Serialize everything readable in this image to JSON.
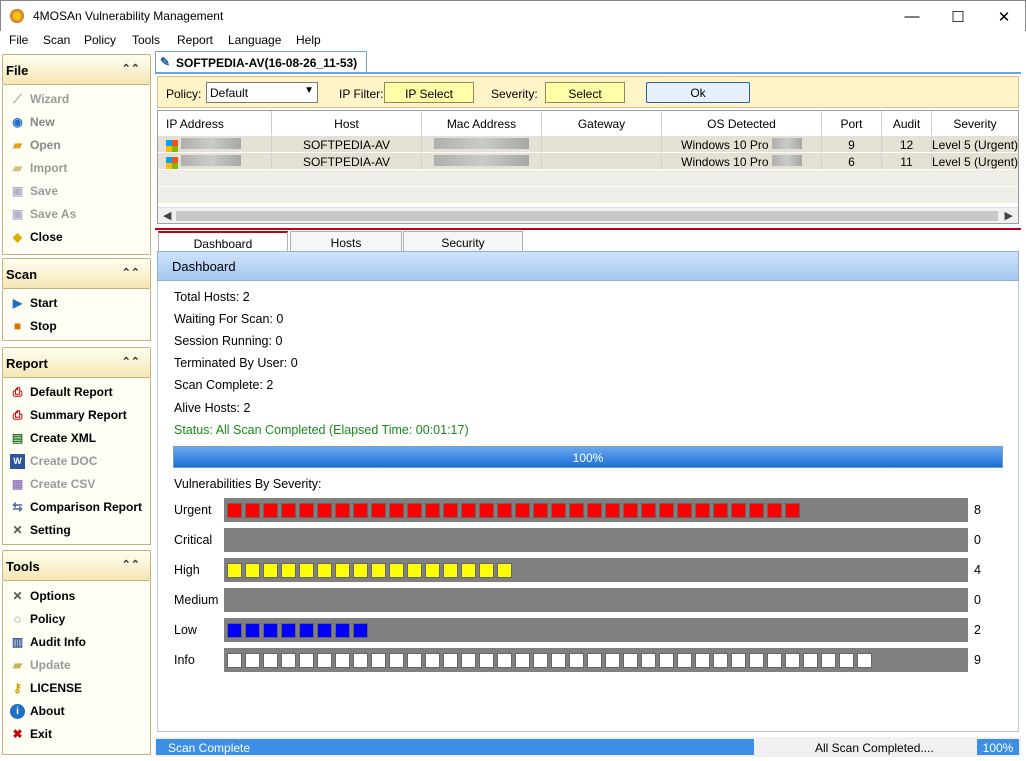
{
  "window": {
    "title": "4MOSAn Vulnerability Management",
    "minimize": "—",
    "maximize": "☐",
    "close": "✕"
  },
  "menu": [
    "File",
    "Scan",
    "Policy",
    "Tools",
    "Report",
    "Language",
    "Help"
  ],
  "sidebar": {
    "file": {
      "title": "File",
      "items": [
        {
          "label": "Wizard",
          "icon": "wizard-wand-icon",
          "disabled": true
        },
        {
          "label": "New",
          "icon": "new-search-icon",
          "disabled": false
        },
        {
          "label": "Open",
          "icon": "open-folder-icon",
          "disabled": false
        },
        {
          "label": "Import",
          "icon": "import-folder-icon",
          "disabled": true
        },
        {
          "label": "Save",
          "icon": "save-disk-icon",
          "disabled": true
        },
        {
          "label": "Save As",
          "icon": "save-as-icon",
          "disabled": true
        },
        {
          "label": "Close",
          "icon": "close-folder-icon",
          "disabled": false
        }
      ]
    },
    "scan": {
      "title": "Scan",
      "items": [
        {
          "label": "Start",
          "icon": "play-icon",
          "disabled": false
        },
        {
          "label": "Stop",
          "icon": "stop-icon",
          "disabled": false
        }
      ]
    },
    "report": {
      "title": "Report",
      "items": [
        {
          "label": "Default Report",
          "icon": "pdf-report-icon",
          "disabled": false
        },
        {
          "label": "Summary Report",
          "icon": "pdf-summary-icon",
          "disabled": false
        },
        {
          "label": "Create XML",
          "icon": "xml-icon",
          "disabled": false
        },
        {
          "label": "Create DOC",
          "icon": "word-doc-icon",
          "disabled": true
        },
        {
          "label": "Create CSV",
          "icon": "csv-icon",
          "disabled": true
        },
        {
          "label": "Comparison Report",
          "icon": "comparison-icon",
          "disabled": false
        },
        {
          "label": "Setting",
          "icon": "tools-icon",
          "disabled": false
        }
      ]
    },
    "tools": {
      "title": "Tools",
      "items": [
        {
          "label": "Options",
          "icon": "wrench-icon",
          "disabled": false
        },
        {
          "label": "Policy",
          "icon": "policy-icon",
          "disabled": false
        },
        {
          "label": "Audit Info",
          "icon": "audit-icon",
          "disabled": false
        },
        {
          "label": "Update",
          "icon": "update-icon",
          "disabled": true
        },
        {
          "label": "LICENSE",
          "icon": "key-icon",
          "disabled": false
        },
        {
          "label": "About",
          "icon": "info-icon",
          "disabled": false
        },
        {
          "label": "Exit",
          "icon": "exit-x-icon",
          "disabled": false
        }
      ]
    }
  },
  "session_tab": "SOFTPEDIA-AV(16-08-26_11-53)",
  "filters": {
    "policy_label": "Policy:",
    "policy_value": "Default",
    "ip_filter_label": "IP Filter:",
    "ip_select": "IP Select",
    "severity_label": "Severity:",
    "severity_select": "Select",
    "ok": "Ok"
  },
  "grid": {
    "columns": [
      "IP Address",
      "Host",
      "Mac Address",
      "Gateway",
      "OS Detected",
      "Port",
      "Audit",
      "Severity"
    ],
    "rows": [
      {
        "host": "SOFTPEDIA-AV",
        "os": "Windows 10 Pro",
        "port": "9",
        "audit": "12",
        "severity": "Level 5 (Urgent)"
      },
      {
        "host": "SOFTPEDIA-AV",
        "os": "Windows 10 Pro",
        "port": "6",
        "audit": "11",
        "severity": "Level 5 (Urgent)"
      }
    ]
  },
  "tabs": [
    "Dashboard",
    "Hosts",
    "Security"
  ],
  "dashboard": {
    "header": "Dashboard",
    "stats": [
      "Total Hosts: 2",
      "Waiting For Scan: 0",
      "Session Running: 0",
      "Terminated By User: 0",
      "Scan Complete: 2",
      "Alive Hosts: 2"
    ],
    "status": "Status: All Scan Completed (Elapsed Time: 00:01:17)",
    "progress_label": "100%",
    "progress": 1.0,
    "vuln_title": "Vulnerabilities By Severity:",
    "severities": [
      {
        "label": "Urgent",
        "count": "8",
        "segments": 32,
        "color": "#ff0000"
      },
      {
        "label": "Critical",
        "count": "0",
        "segments": 0,
        "color": "#ff0000"
      },
      {
        "label": "High",
        "count": "4",
        "segments": 16,
        "color": "#ffff00"
      },
      {
        "label": "Medium",
        "count": "0",
        "segments": 0,
        "color": "#ffa500"
      },
      {
        "label": "Low",
        "count": "2",
        "segments": 8,
        "color": "#0000ff"
      },
      {
        "label": "Info",
        "count": "9",
        "segments": 36,
        "color": "#ffffff"
      }
    ]
  },
  "statusbar": {
    "left": "Scan Complete",
    "middle": "All Scan Completed....",
    "right": "100%"
  }
}
